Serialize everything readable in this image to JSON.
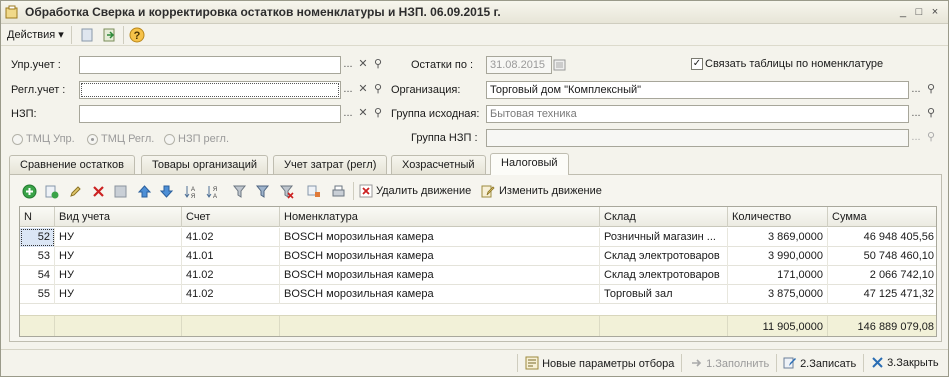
{
  "window": {
    "title": "Обработка  Сверка и корректировка остатков номенклатуры и НЗП. 06.09.2015 г.",
    "controls": [
      "_",
      "□",
      "×"
    ]
  },
  "toolbar": {
    "actions_label": "Действия",
    "actions_arrow": "▾"
  },
  "form": {
    "upr_label": "Упр.учет :",
    "upr_value": "",
    "regl_label": "Регл.учет :",
    "regl_value": "",
    "nzp_label": "НЗП:",
    "nzp_value": "",
    "ostatki_label": "Остатки по :",
    "ostatki_value": "31.08.2015",
    "link_checkbox_label": "Связать таблицы по номенклатуре",
    "link_checkbox_checked": true,
    "org_label": "Организация:",
    "org_value": "Торговый дом \"Комплексный\"",
    "group_src_label": "Группа исходная:",
    "group_src_value": "Бытовая техника",
    "group_nzp_label": "Группа НЗП :",
    "group_nzp_value": "",
    "radios": [
      {
        "label": "ТМЦ Упр.",
        "selected": false
      },
      {
        "label": "ТМЦ Регл.",
        "selected": true
      },
      {
        "label": "НЗП регл.",
        "selected": false
      }
    ],
    "select_glyph": "...",
    "clear_glyph": "✕",
    "search_glyph": "⚲"
  },
  "tabs": [
    {
      "label": "Сравнение остатков",
      "active": false
    },
    {
      "label": "Товары организаций",
      "active": false
    },
    {
      "label": "Учет затрат (регл)",
      "active": false
    },
    {
      "label": "Хозрасчетный",
      "active": false
    },
    {
      "label": "Налоговый",
      "active": true
    }
  ],
  "panel_toolbar": {
    "delete_move_label": "Удалить движение",
    "edit_move_label": "Изменить движение",
    "icons": [
      "add-icon",
      "copy-add-icon",
      "edit-icon",
      "delete-icon",
      "save-icon",
      "move-up-icon",
      "move-down-icon",
      "sort-asc-icon",
      "sort-desc-icon",
      "filter-icon",
      "filter-set-icon",
      "filter-clear-icon",
      "structure-icon",
      "print-icon"
    ]
  },
  "table": {
    "columns": [
      "N",
      "Вид учета",
      "Счет",
      "Номенклатура",
      "Склад",
      "Количество",
      "Сумма"
    ],
    "rows": [
      {
        "n": "52",
        "vid": "НУ",
        "schet": "41.02",
        "nom": "BOSCH морозильная камера",
        "sklad": "Розничный магазин ...",
        "qty": "3 869,0000",
        "sum": "46 948 405,56"
      },
      {
        "n": "53",
        "vid": "НУ",
        "schet": "41.01",
        "nom": "BOSCH морозильная камера",
        "sklad": "Склад электротоваров",
        "qty": "3 990,0000",
        "sum": "50 748 460,10"
      },
      {
        "n": "54",
        "vid": "НУ",
        "schet": "41.02",
        "nom": "BOSCH морозильная камера",
        "sklad": "Склад электротоваров",
        "qty": "171,0000",
        "sum": "2 066 742,10"
      },
      {
        "n": "55",
        "vid": "НУ",
        "schet": "41.02",
        "nom": "BOSCH морозильная камера",
        "sklad": "Торговый зал",
        "qty": "3 875,0000",
        "sum": "47 125 471,32"
      }
    ],
    "totals": {
      "qty": "11 905,0000",
      "sum": "146 889 079,08"
    }
  },
  "bottom": {
    "new_params_label": "Новые параметры отбора",
    "fill_label": "1.Заполнить",
    "write_label": "2.Записать",
    "close_label": "3.Закрыть"
  },
  "colors": {
    "accent": "#2a6db3",
    "delete_red": "#cc2222",
    "add_green": "#2e9a3a",
    "selected_cell": "#dbe6f5"
  }
}
